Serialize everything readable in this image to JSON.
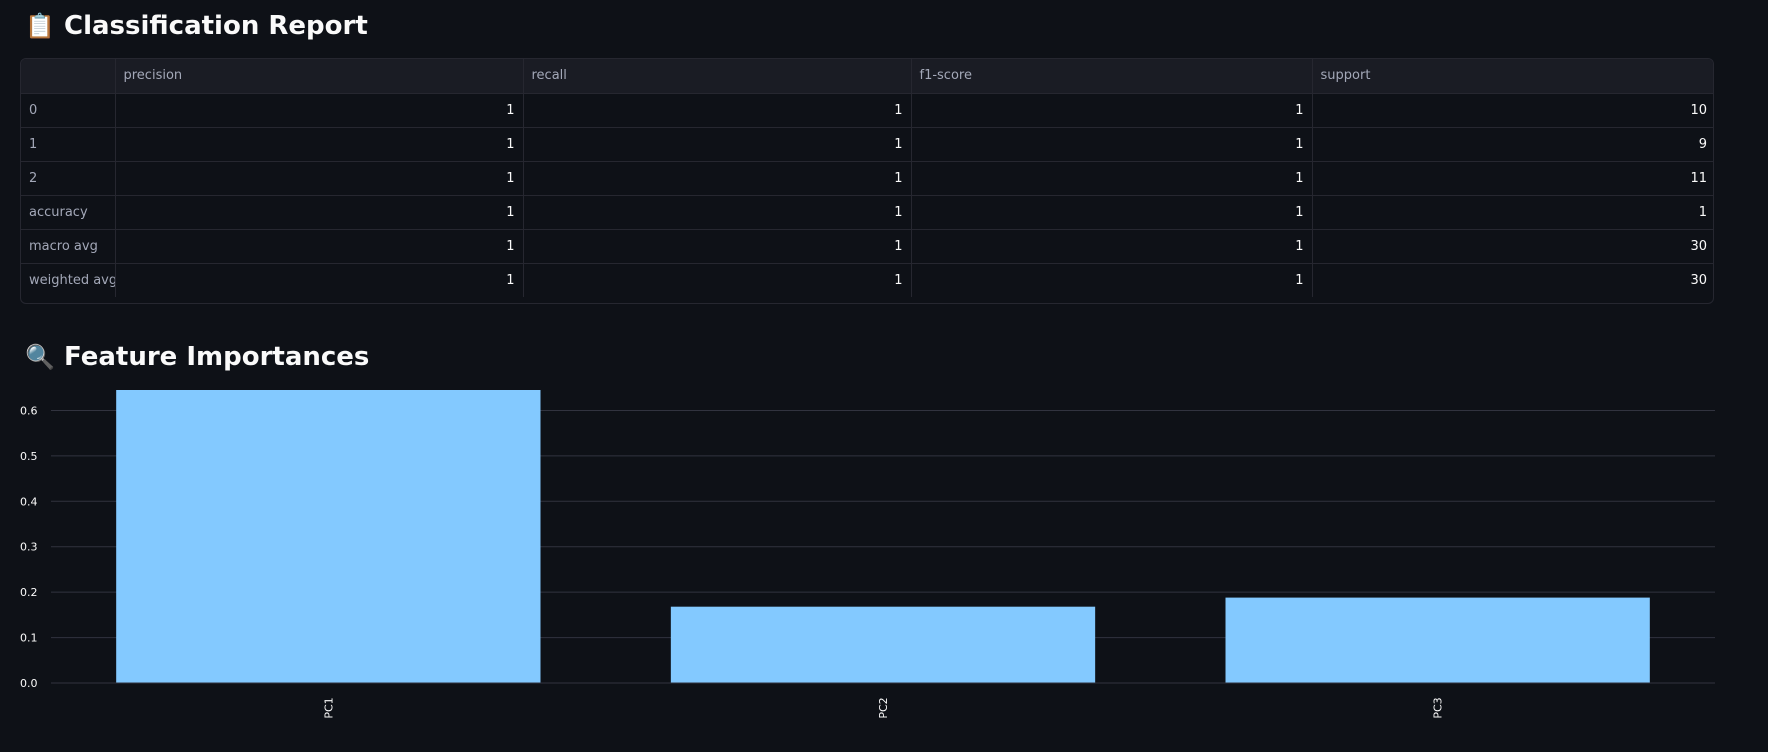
{
  "report": {
    "icon": "clipboard-icon",
    "icon_glyph": "📋",
    "title": "Classification Report",
    "columns": [
      "",
      "precision",
      "recall",
      "f1-score",
      "support"
    ],
    "rows": [
      {
        "label": "0",
        "values": [
          "1",
          "1",
          "1",
          "10"
        ]
      },
      {
        "label": "1",
        "values": [
          "1",
          "1",
          "1",
          "9"
        ]
      },
      {
        "label": "2",
        "values": [
          "1",
          "1",
          "1",
          "11"
        ]
      },
      {
        "label": "accuracy",
        "values": [
          "1",
          "1",
          "1",
          "1"
        ]
      },
      {
        "label": "macro avg",
        "values": [
          "1",
          "1",
          "1",
          "30"
        ]
      },
      {
        "label": "weighted avg",
        "values": [
          "1",
          "1",
          "1",
          "30"
        ]
      }
    ]
  },
  "features": {
    "icon": "magnifier-icon",
    "icon_glyph": "🔍",
    "title": "Feature Importances"
  },
  "chart_data": {
    "type": "bar",
    "categories": [
      "PC1",
      "PC2",
      "PC3"
    ],
    "values": [
      0.645,
      0.168,
      0.188
    ],
    "title": "",
    "xlabel": "",
    "ylabel": "",
    "ylim": [
      0,
      0.645
    ],
    "yticks": [
      0.0,
      0.1,
      0.2,
      0.3,
      0.4,
      0.5,
      0.6
    ],
    "ytick_labels": [
      "0.0",
      "0.1",
      "0.2",
      "0.3",
      "0.4",
      "0.5",
      "0.6"
    ],
    "grid": true,
    "bar_color": "#83c9ff",
    "grid_color": "#31333f"
  }
}
